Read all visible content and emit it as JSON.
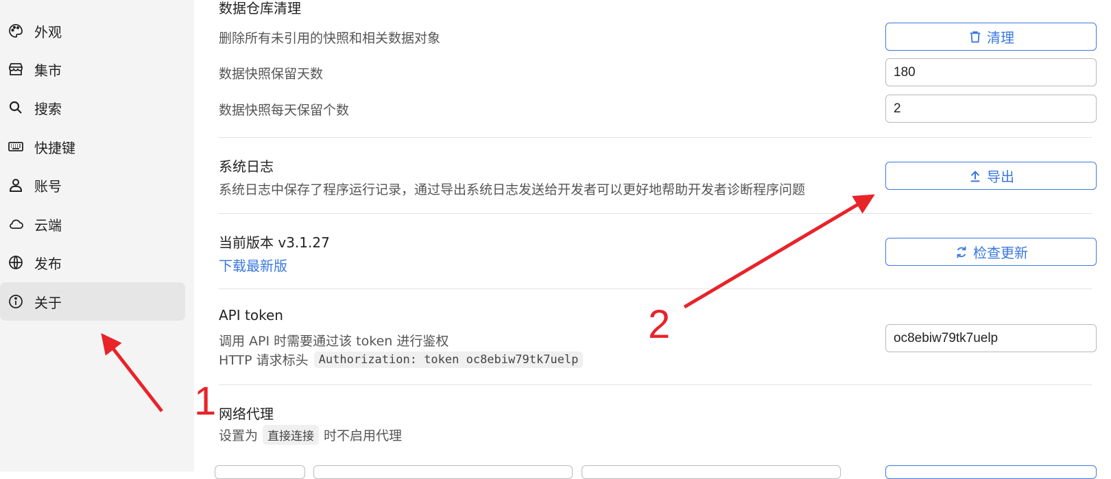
{
  "sidebar": {
    "items": [
      {
        "label": "外观",
        "icon": "palette-icon"
      },
      {
        "label": "集市",
        "icon": "store-icon"
      },
      {
        "label": "搜索",
        "icon": "search-icon"
      },
      {
        "label": "快捷键",
        "icon": "keyboard-icon"
      },
      {
        "label": "账号",
        "icon": "user-icon"
      },
      {
        "label": "云端",
        "icon": "cloud-icon"
      },
      {
        "label": "发布",
        "icon": "globe-icon"
      },
      {
        "label": "关于",
        "icon": "info-icon",
        "active": true
      }
    ]
  },
  "main": {
    "repo_cleanup": {
      "title": "数据仓库清理",
      "desc": "删除所有未引用的快照和相关数据对象",
      "button_label": "清理",
      "retain_days_label": "数据快照保留天数",
      "retain_days_value": "180",
      "retain_count_label": "数据快照每天保留个数",
      "retain_count_value": "2"
    },
    "system_log": {
      "title": "系统日志",
      "desc": "系统日志中保存了程序运行记录，通过导出系统日志发送给开发者可以更好地帮助开发者诊断程序问题",
      "button_label": "导出"
    },
    "version": {
      "title": "当前版本 v3.1.27",
      "download_link": "下载最新版",
      "button_label": "检查更新"
    },
    "api_token": {
      "title": "API token",
      "desc": "调用 API 时需要通过该 token 进行鉴权",
      "header_prefix": "HTTP 请求标头",
      "header_code": "Authorization: token oc8ebiw79tk7uelp",
      "value": "oc8ebiw79tk7uelp"
    },
    "proxy": {
      "title": "网络代理",
      "desc_prefix": "设置为",
      "desc_code": "直接连接",
      "desc_suffix": "时不启用代理"
    }
  },
  "annotations": {
    "label_1": "1",
    "label_2": "2",
    "color": "#e8232a"
  }
}
